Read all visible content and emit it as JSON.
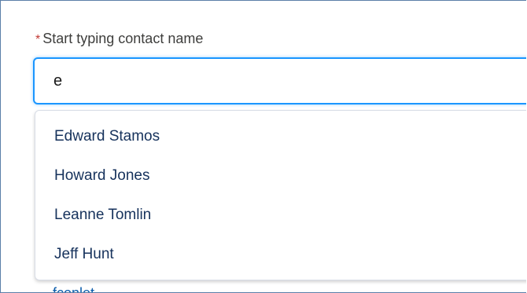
{
  "contact_field": {
    "required_mark": "*",
    "label": "Start typing contact name",
    "value": "e"
  },
  "suggestions": [
    {
      "label": "Edward Stamos"
    },
    {
      "label": "Howard Jones"
    },
    {
      "label": "Leanne Tomlin"
    },
    {
      "label": "Jeff Hunt"
    }
  ],
  "below_link": {
    "text": "fconlet"
  },
  "colors": {
    "focus_border": "#1b96ff",
    "required": "#c23934",
    "option_text": "#16325c",
    "link": "#0b5cab"
  }
}
